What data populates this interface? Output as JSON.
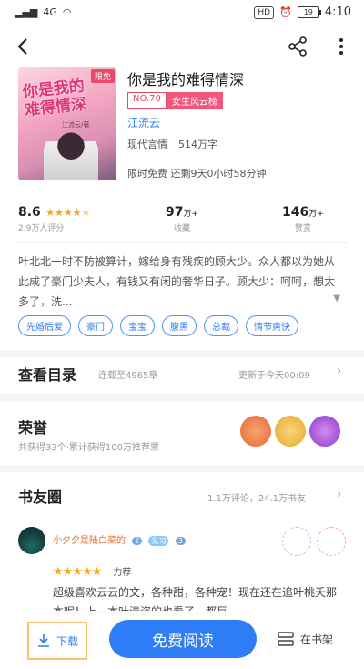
{
  "status": {
    "net": "4G",
    "hd": "HD",
    "battery": "19",
    "time": "4:10"
  },
  "book": {
    "title": "你是我的难得情深",
    "cover": {
      "tag": "限免",
      "title_line1": "你是我的",
      "title_line2": "难得情深",
      "author": "江流云/著"
    },
    "rank_badge": "NO.70",
    "rank_list": "女生风云榜",
    "author": "江流云",
    "genre": "现代言情",
    "word_count": "514万字",
    "free_notice": "限时免费 还剩9天0小时58分钟"
  },
  "stats": {
    "rating": "8.6",
    "rating_stars": 4.5,
    "rating_label": "2.9万人评分",
    "favorites": "97",
    "favorites_unit": "万+",
    "favorites_label": "收藏",
    "likes": "146",
    "likes_unit": "万+",
    "likes_label": "赞赏"
  },
  "description": "叶北北一时不防被算计，嫁给身有残疾的顾大少。众人都以为她从此成了豪门少夫人，有钱又有闲的奢华日子。顾大少：呵呵，想太多了，洗...",
  "tags": [
    "先婚后爱",
    "豪门",
    "宝宝",
    "腹黑",
    "总裁",
    "情节爽快"
  ],
  "catalog": {
    "title": "查看目录",
    "serial": "连载至4965章",
    "update": "更新于今天00:09"
  },
  "honor": {
    "title": "荣誉",
    "summary": "共获得33个·累计获得100万推荐票"
  },
  "circle": {
    "title": "书友圈",
    "stats": "1.1万评论，24.1万书友",
    "post": {
      "user": "小夕夕是陆白菜的",
      "level1": "2",
      "level2": "见习",
      "level3": "3",
      "rating_stars": 5,
      "rating_text": "力荐",
      "text": "超级喜欢云云的文，各种甜，各种宠！现在还在追叶桃夭那本呢！上一本叶清姿的也看了，都巨"
    }
  },
  "bottom": {
    "download": "下载",
    "read": "免费阅读",
    "shelf": "在书架"
  },
  "colors": {
    "accent": "#2e7cf6",
    "rank": "#e84a6a",
    "star": "#f5a623"
  }
}
